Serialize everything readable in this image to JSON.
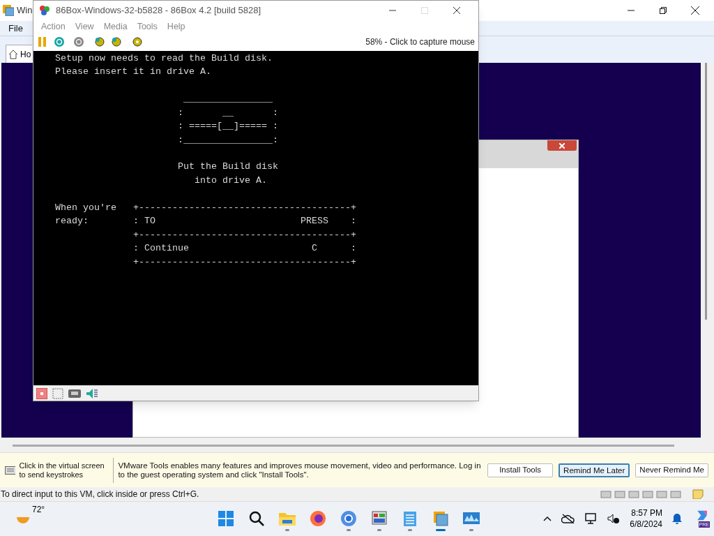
{
  "host_window": {
    "title": "Win",
    "menu": [
      "File"
    ],
    "tab": {
      "label": "Ho",
      "selected": true
    }
  },
  "emulator_window": {
    "title": "86Box-Windows-32-b5828 - 86Box 4.2 [build 5828]",
    "menu": [
      "Action",
      "View",
      "Media",
      "Tools",
      "Help"
    ],
    "toolbar_status": "58% - Click to capture mouse",
    "console": [
      {
        "lines": [
          "Setup now needs to read the Build disk.",
          "Please insert it in drive A."
        ]
      },
      {
        "lines": [
          "                       ________________",
          "                      :       __       :",
          "                      : =====[__]===== :",
          "                      :________________:"
        ]
      },
      {
        "lines": [
          "                      Put the Build disk",
          "                         into drive A."
        ]
      },
      {
        "lines": [
          "When you're   +--------------------------------------+",
          "ready:        : TO                          PRESS    :",
          "              +--------------------------------------+",
          "              : Continue                      C      :",
          "              +--------------------------------------+"
        ]
      }
    ]
  },
  "notification": {
    "hint": "Click in the virtual screen to send keystrokes",
    "message": "VMware Tools enables many features and improves mouse movement, video and performance. Log in to the guest operating system and click \"Install Tools\".",
    "buttons": [
      {
        "label": "Install Tools",
        "focused": false
      },
      {
        "label": "Remind Me Later",
        "focused": true
      },
      {
        "label": "Never Remind Me",
        "focused": false
      }
    ]
  },
  "status_bar": {
    "text": "To direct input to this VM, click inside or press Ctrl+G."
  },
  "taskbar": {
    "weather": "72°",
    "apps": [
      {
        "running": false,
        "active": false
      },
      {
        "running": false,
        "active": false
      },
      {
        "running": true,
        "active": false
      },
      {
        "running": false,
        "active": false
      },
      {
        "running": true,
        "active": false
      },
      {
        "running": true,
        "active": false
      },
      {
        "running": true,
        "active": false
      },
      {
        "running": true,
        "active": true
      },
      {
        "running": true,
        "active": false
      }
    ],
    "time": "8:57 PM",
    "date": "6/8/2024",
    "copilot_badge": "PRE"
  }
}
